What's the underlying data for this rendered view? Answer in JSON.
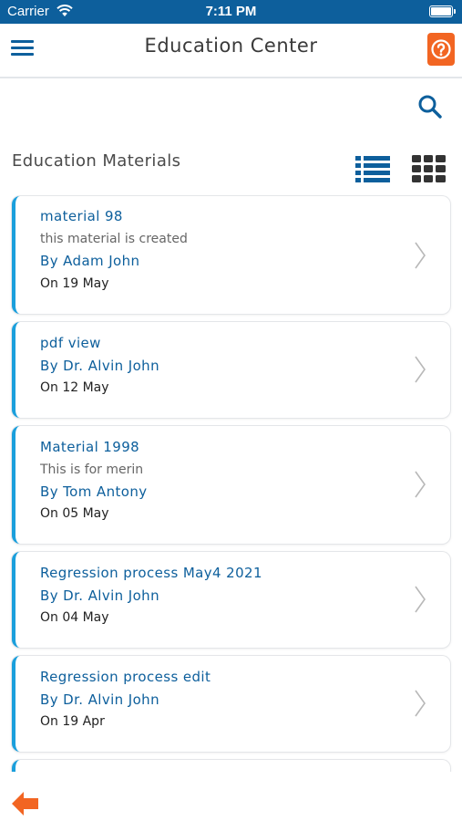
{
  "status_bar": {
    "carrier": "Carrier",
    "time": "7:11 PM"
  },
  "header": {
    "title": "Education Center",
    "menu_icon": "hamburger-menu-icon",
    "help_icon": "question-mark-icon"
  },
  "search": {
    "icon": "search-icon"
  },
  "section": {
    "title": "Education Materials",
    "list_view_icon": "list-view-icon",
    "grid_view_icon": "grid-view-icon"
  },
  "materials": [
    {
      "title": "material 98",
      "description": "this material is created",
      "author": "By Adam John",
      "date": "On  19 May"
    },
    {
      "title": "pdf view",
      "description": "",
      "author": "By Dr. Alvin John",
      "date": "On  12 May"
    },
    {
      "title": "Material 1998",
      "description": "This is for merin",
      "author": "By Tom Antony",
      "date": "On  05 May"
    },
    {
      "title": "Regression process May4 2021",
      "description": "",
      "author": "By Dr. Alvin John",
      "date": "On  04 May"
    },
    {
      "title": "Regression process edit",
      "description": "",
      "author": "By Dr. Alvin John",
      "date": "On  19 Apr"
    }
  ],
  "footer": {
    "back_icon": "back-arrow-icon"
  },
  "colors": {
    "primary": "#0d5f9c",
    "accent": "#f26522",
    "card_stripe": "#1a9fdc"
  }
}
